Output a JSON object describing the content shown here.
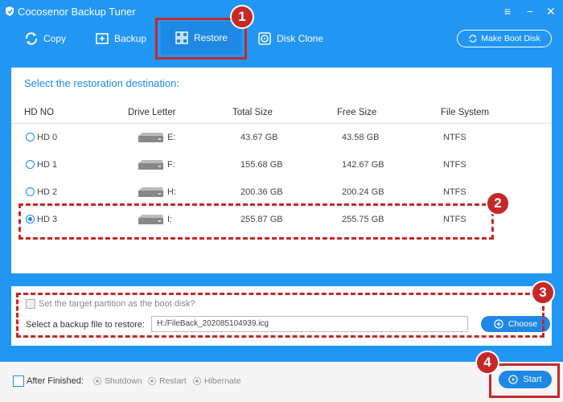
{
  "app": {
    "title": "Cocosenor Backup Tuner",
    "icon": "shield-icon"
  },
  "window_controls": {
    "menu_icon": "≡",
    "minimize_icon": "−",
    "close_icon": "✕"
  },
  "toolbar": {
    "copy_label": "Copy",
    "backup_label": "Backup",
    "restore_label": "Restore",
    "disk_clone_label": "Disk Clone",
    "make_boot_label": "Make Boot Disk",
    "active_tab": "Restore"
  },
  "main": {
    "title": "Select the restoration destination:",
    "columns": [
      "HD NO",
      "Drive Letter",
      "Total Size",
      "Free Size",
      "File System"
    ],
    "rows": [
      {
        "hd": "HD 0",
        "letter": "E:",
        "total": "43.67 GB",
        "free": "43.58 GB",
        "fs": "NTFS",
        "selected": false
      },
      {
        "hd": "HD 1",
        "letter": "F:",
        "total": "155.68 GB",
        "free": "142.67 GB",
        "fs": "NTFS",
        "selected": false
      },
      {
        "hd": "HD 2",
        "letter": "H:",
        "total": "200.36 GB",
        "free": "200.24 GB",
        "fs": "NTFS",
        "selected": false
      },
      {
        "hd": "HD 3",
        "letter": "I:",
        "total": "255.87 GB",
        "free": "255.75 GB",
        "fs": "NTFS",
        "selected": true
      }
    ]
  },
  "options": {
    "boot_disk_label": "Set the target partition as the boot disk?",
    "backup_file_label": "Select a backup file to restore:",
    "backup_file_value": "H:/FileBack_202085104939.icg",
    "choose_label": "Choose"
  },
  "bottom": {
    "after_finished_label": "After Finished:",
    "after_options": [
      "Shutdown",
      "Restart",
      "Hibernate"
    ],
    "start_label": "Start"
  },
  "annotations": {
    "step1": "1",
    "step2": "2",
    "step3": "3",
    "step4": "4"
  },
  "colors": {
    "brand_blue": "#2196f3",
    "accent_blue": "#1e88e5",
    "annotation_red": "#c62828"
  }
}
